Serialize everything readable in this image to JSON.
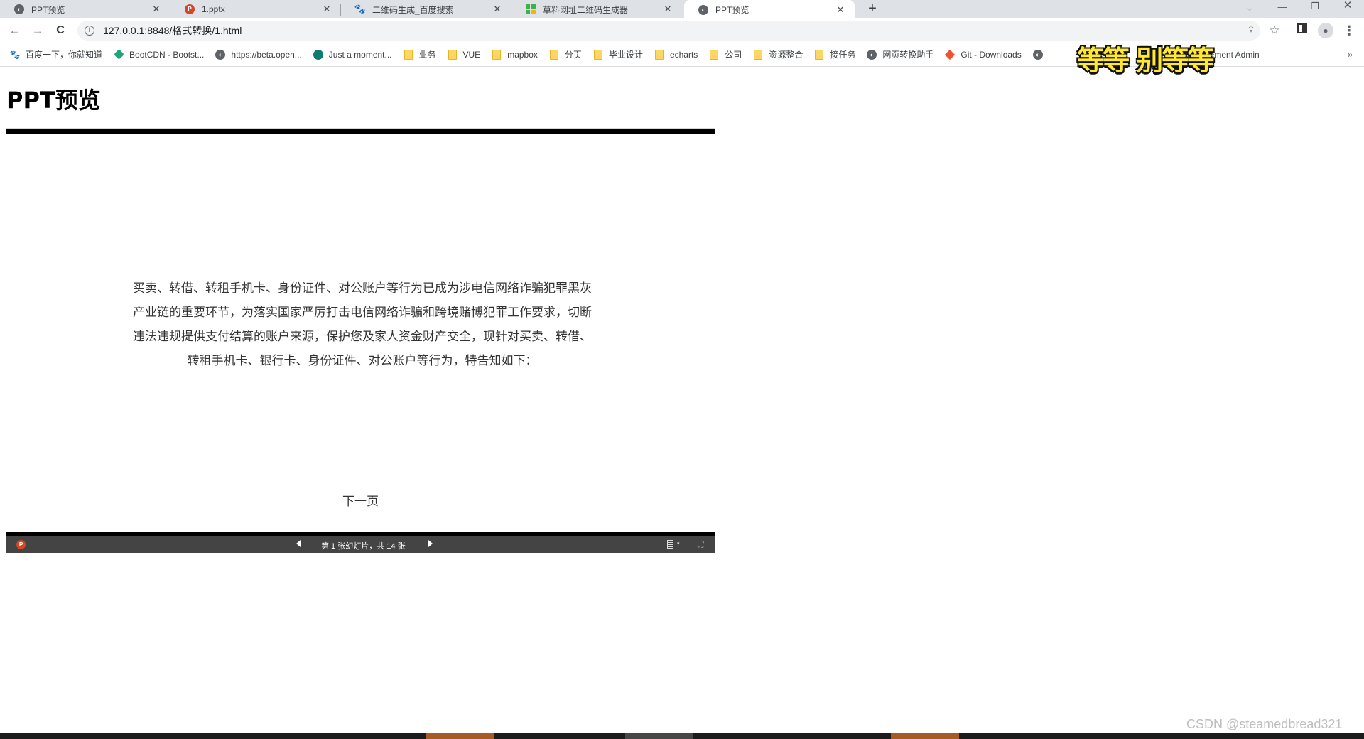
{
  "browser": {
    "tabs": [
      {
        "title": "PPT预览",
        "icon": "globe-icon",
        "active": false
      },
      {
        "title": "1.pptx",
        "icon": "powerpoint-icon",
        "active": false
      },
      {
        "title": "二维码生成_百度搜索",
        "icon": "baidu-paw-icon",
        "active": false
      },
      {
        "title": "草料网址二维码生成器",
        "icon": "caoliao-qr-icon",
        "active": false
      },
      {
        "title": "PPT预览",
        "icon": "globe-icon",
        "active": true
      }
    ],
    "tab_close_glyph": "✕",
    "new_tab_glyph": "+",
    "window_controls": {
      "tab_search": "⌵",
      "minimize": "—",
      "restore": "❐",
      "close": "✕"
    },
    "nav": {
      "back": "←",
      "forward": "→",
      "reload": "C"
    },
    "address": {
      "info_glyph": "i",
      "url": "127.0.0.1:8848/格式转换/1.html"
    },
    "toolbar_icons": {
      "share": "⇪",
      "star": "☆",
      "side_panel": "▮",
      "profile": "●",
      "menu": "⋮"
    },
    "bookmarks": [
      {
        "label": "百度一下，你就知道",
        "icon": "baidu-paw-icon"
      },
      {
        "label": "BootCDN - Bootst...",
        "icon": "bootcdn-icon"
      },
      {
        "label": "https://beta.open...",
        "icon": "globe-icon"
      },
      {
        "label": "Just a moment...",
        "icon": "openai-icon"
      },
      {
        "label": "业务",
        "icon": "folder-icon"
      },
      {
        "label": "VUE",
        "icon": "folder-icon"
      },
      {
        "label": "mapbox",
        "icon": "folder-icon"
      },
      {
        "label": "分页",
        "icon": "folder-icon"
      },
      {
        "label": "毕业设计",
        "icon": "folder-icon"
      },
      {
        "label": "echarts",
        "icon": "folder-icon"
      },
      {
        "label": "公司",
        "icon": "folder-icon"
      },
      {
        "label": "资源整合",
        "icon": "folder-icon"
      },
      {
        "label": "接任务",
        "icon": "folder-icon"
      },
      {
        "label": "网页转换助手",
        "icon": "globe-icon"
      },
      {
        "label": "Git - Downloads",
        "icon": "git-icon"
      },
      {
        "label": "",
        "icon": "globe-icon"
      },
      {
        "label": "",
        "icon": "globe-icon"
      },
      {
        "label": "Vue Element Admin",
        "icon": "vue-icon"
      }
    ],
    "bookmarks_more": "»",
    "overlay_sticker": "等等 别等等"
  },
  "page": {
    "title": "PPT预览",
    "slide": {
      "lines": [
        "买卖、转借、转租手机卡、身份证件、对公账户等行为已成为涉电信网络诈骗犯罪黑灰",
        "产业链的重要环节，为落实国家严厉打击电信网络诈骗和跨境赌博犯罪工作要求，切断",
        "违法违规提供支付结算的账户来源，保护您及家人资金财产交全，现针对买卖、转借、",
        "转租手机卡、银行卡、身份证件、对公账户等行为，特告知如下："
      ],
      "next_page": "下一页"
    },
    "controls": {
      "logo": "P",
      "slide_counter": "第 1 张幻灯片，共 14 张",
      "current_slide": 1,
      "total_slides": 14,
      "notes_caret": "▾",
      "fullscreen_glyph": "⛶"
    }
  },
  "watermark": "CSDN @steamedbread321",
  "taskbar": {
    "colors": {
      "bg": "#1c1c1c",
      "active": "#a65a24",
      "hover": "#474747"
    }
  }
}
